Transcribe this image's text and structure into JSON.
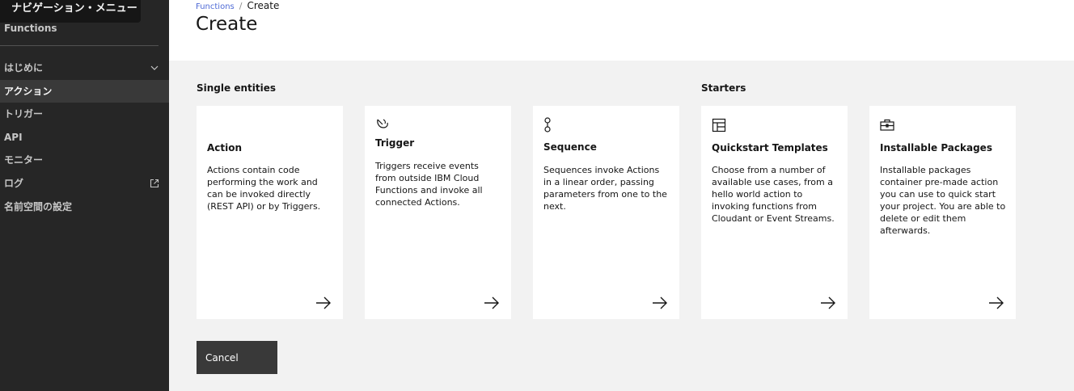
{
  "sidebar": {
    "tooltip": "ナビゲーション・メニュー",
    "title": "Functions",
    "items": [
      {
        "label": "はじめに"
      },
      {
        "label": "アクション"
      },
      {
        "label": "トリガー"
      },
      {
        "label": "API"
      },
      {
        "label": "モニター"
      },
      {
        "label": "ログ"
      },
      {
        "label": "名前空間の設定"
      }
    ]
  },
  "header": {
    "breadcrumb": {
      "root": "Functions",
      "separator": "/",
      "current": "Create"
    },
    "title": "Create"
  },
  "sections": {
    "single": "Single entities",
    "starters": "Starters"
  },
  "cards": [
    {
      "title": "Action",
      "icon": "lightning-icon",
      "desc": "Actions contain code performing the work and can be invoked directly (REST API) or by Triggers."
    },
    {
      "title": "Trigger",
      "icon": "trigger-icon",
      "desc": "Triggers receive events from outside IBM Cloud Functions and invoke all connected Actions."
    },
    {
      "title": "Sequence",
      "icon": "sequence-icon",
      "desc": "Sequences invoke Actions in a linear order, passing parameters from one to the next."
    },
    {
      "title": "Quickstart Templates",
      "icon": "template-icon",
      "desc": "Choose from a number of available use cases, from a hello world action to invoking functions from Cloudant or Event Streams."
    },
    {
      "title": "Installable Packages",
      "icon": "package-icon",
      "desc": "Installable packages container pre-made action you can use to quick start your project. You are able to delete or edit them afterwards."
    }
  ],
  "actions": {
    "cancel": "Cancel"
  },
  "colors": {
    "sidebar": "#262626",
    "active_item": "#393939",
    "link": "#4f6bd6",
    "background": "#f2f2f2"
  }
}
